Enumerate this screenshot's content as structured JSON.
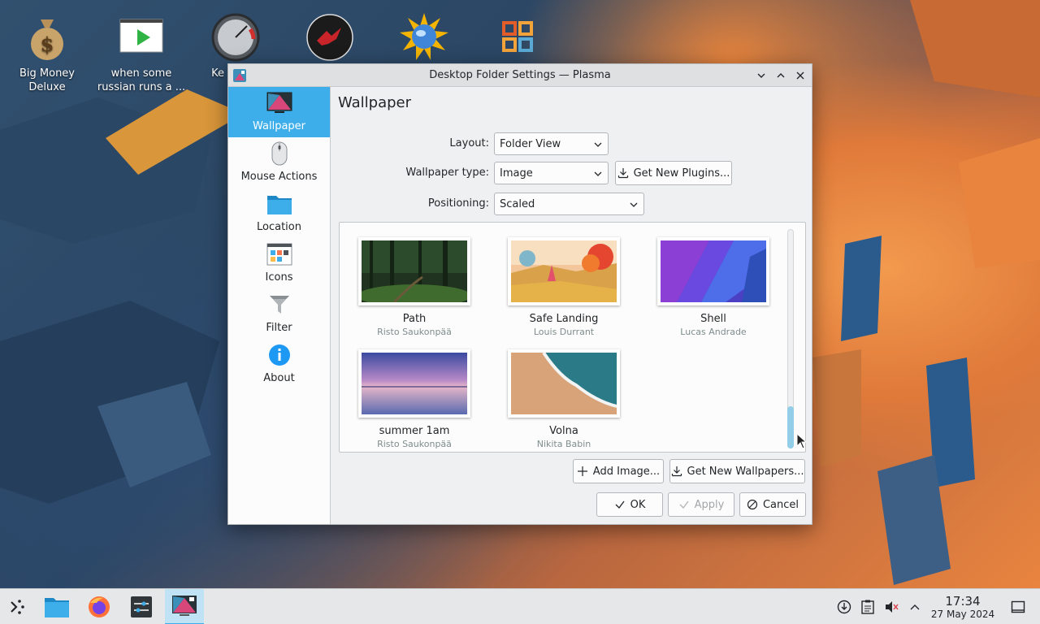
{
  "desktop": {
    "icons": [
      {
        "label": "Big Money Deluxe",
        "icon": "money-bag-icon"
      },
      {
        "label": "when some russian runs a ...",
        "icon": "video-thumbnail-icon"
      },
      {
        "label": "Ke Optim",
        "icon": "speedometer-icon"
      },
      {
        "label": "",
        "icon": "dragon-logo-icon"
      },
      {
        "label": "",
        "icon": "globe-sun-icon"
      },
      {
        "label": "",
        "icon": "grid-app-icon"
      }
    ]
  },
  "window": {
    "title": "Desktop Folder Settings — Plasma",
    "sidebar": [
      {
        "label": "Wallpaper",
        "icon": "wallpaper-icon",
        "active": true
      },
      {
        "label": "Mouse Actions",
        "icon": "mouse-icon",
        "active": false
      },
      {
        "label": "Location",
        "icon": "folder-icon",
        "active": false
      },
      {
        "label": "Icons",
        "icon": "icons-icon",
        "active": false
      },
      {
        "label": "Filter",
        "icon": "filter-icon",
        "active": false
      },
      {
        "label": "About",
        "icon": "info-icon",
        "active": false
      }
    ],
    "page_title": "Wallpaper",
    "form": {
      "layout_label": "Layout:",
      "layout_value": "Folder View",
      "wallpaper_type_label": "Wallpaper type:",
      "wallpaper_type_value": "Image",
      "get_plugins_label": "Get New Plugins...",
      "positioning_label": "Positioning:",
      "positioning_value": "Scaled"
    },
    "wallpapers": [
      {
        "name": "Path",
        "author": "Risto Saukonpää"
      },
      {
        "name": "Safe Landing",
        "author": "Louis Durrant"
      },
      {
        "name": "Shell",
        "author": "Lucas Andrade"
      },
      {
        "name": "summer 1am",
        "author": "Risto Saukonpää"
      },
      {
        "name": "Volna",
        "author": "Nikita Babin"
      }
    ],
    "buttons": {
      "add_image": "Add Image...",
      "get_new_wallpapers": "Get New Wallpapers...",
      "ok": "OK",
      "apply": "Apply",
      "cancel": "Cancel"
    }
  },
  "taskbar": {
    "items": [
      "launcher-icon",
      "file-manager-icon",
      "firefox-icon",
      "settings-icon",
      "plasma-settings-icon"
    ],
    "clock_time": "17:34",
    "clock_date": "27 May 2024"
  },
  "colors": {
    "accent": "#3daee9",
    "window_bg": "#eff0f1",
    "text": "#232629"
  }
}
